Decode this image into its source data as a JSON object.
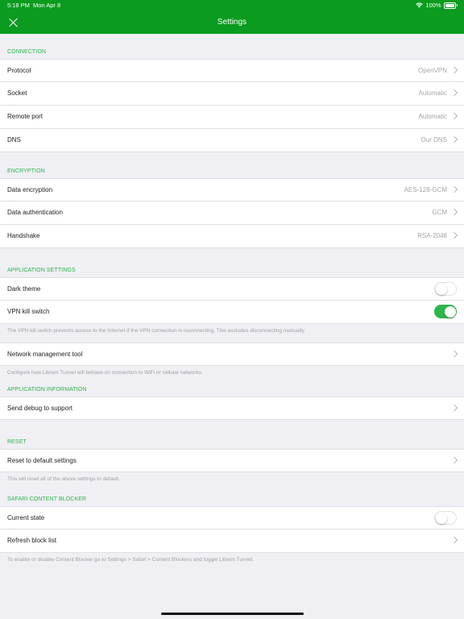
{
  "status_bar": {
    "time": "5:18 PM",
    "date": "Mon Apr 8",
    "battery": "100%"
  },
  "nav": {
    "title": "Settings",
    "close_icon": "close-icon"
  },
  "sections": {
    "connection": {
      "header": "CONNECTION",
      "rows": [
        {
          "label": "Protocol",
          "value": "OpenVPN"
        },
        {
          "label": "Socket",
          "value": "Automatic"
        },
        {
          "label": "Remote port",
          "value": "Automatic"
        },
        {
          "label": "DNS",
          "value": "Our DNS"
        }
      ]
    },
    "encryption": {
      "header": "ENCRYPTION",
      "rows": [
        {
          "label": "Data encryption",
          "value": "AES-128-GCM"
        },
        {
          "label": "Data authentication",
          "value": "GCM"
        },
        {
          "label": "Handshake",
          "value": "RSA-2048"
        }
      ]
    },
    "application_settings": {
      "header": "APPLICATION SETTINGS",
      "dark_theme": {
        "label": "Dark theme",
        "enabled": false
      },
      "kill_switch": {
        "label": "VPN kill switch",
        "enabled": true
      },
      "kill_switch_note": "The VPN kill switch prevents access to the Internet if the VPN connection is reconnecting. This excludes disconnecting manually.",
      "network_tool": {
        "label": "Network management tool"
      },
      "network_tool_note": "Configure how Librem Tunnel will behave on connection to WiFi or cellular networks."
    },
    "application_information": {
      "header": "APPLICATION INFORMATION",
      "debug": {
        "label": "Send debug to support"
      }
    },
    "reset": {
      "header": "RESET",
      "reset_row": {
        "label": "Reset to default settings"
      },
      "note": "This will reset all of the above settings to default."
    },
    "content_blocker": {
      "header": "SAFARI CONTENT BLOCKER",
      "current_state": {
        "label": "Current state",
        "enabled": false
      },
      "refresh": {
        "label": "Refresh block list"
      },
      "note": "To enable or disable Content Blocker go to Settings > Safari > Content Blockers and toggle Librem Tunnel."
    }
  },
  "colors": {
    "brand_green": "#0a9b1f",
    "accent_green": "#2fb44a",
    "toggle_on": "#2db74a",
    "background": "#efeff4"
  }
}
